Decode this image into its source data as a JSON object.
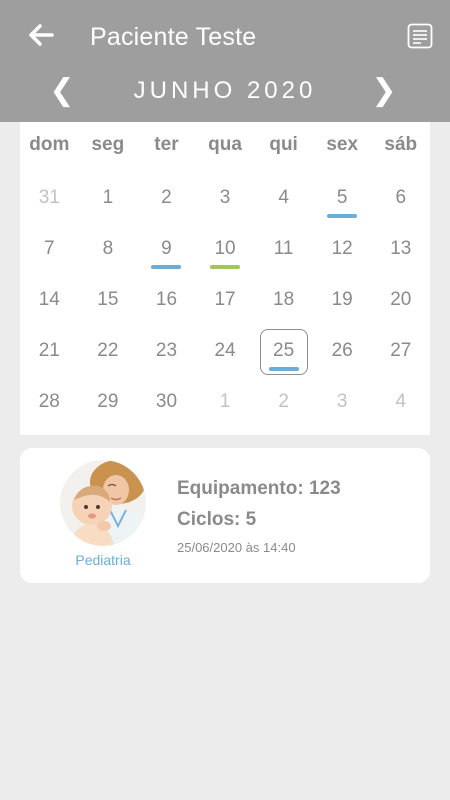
{
  "header": {
    "title": "Paciente Teste",
    "back_icon": "arrow-left-icon",
    "menu_icon": "document-list-icon",
    "background": "#9e9e9e"
  },
  "calendar": {
    "month_label": "JUNHO 2020",
    "prev_icon": "chevron-left-icon",
    "next_icon": "chevron-right-icon",
    "prev_glyph": "❮",
    "next_glyph": "❯",
    "weekdays": [
      "dom",
      "seg",
      "ter",
      "qua",
      "qui",
      "sex",
      "sáb"
    ],
    "weeks": [
      [
        {
          "day": "31",
          "other": true
        },
        {
          "day": "1"
        },
        {
          "day": "2"
        },
        {
          "day": "3"
        },
        {
          "day": "4"
        },
        {
          "day": "5",
          "mark": "#6aaed7"
        },
        {
          "day": "6"
        }
      ],
      [
        {
          "day": "7"
        },
        {
          "day": "8"
        },
        {
          "day": "9",
          "mark": "#6aaed7"
        },
        {
          "day": "10",
          "mark": "#a3c658"
        },
        {
          "day": "11"
        },
        {
          "day": "12"
        },
        {
          "day": "13"
        }
      ],
      [
        {
          "day": "14"
        },
        {
          "day": "15"
        },
        {
          "day": "16"
        },
        {
          "day": "17"
        },
        {
          "day": "18"
        },
        {
          "day": "19"
        },
        {
          "day": "20"
        }
      ],
      [
        {
          "day": "21"
        },
        {
          "day": "22"
        },
        {
          "day": "23"
        },
        {
          "day": "24"
        },
        {
          "day": "25",
          "mark": "#6aaed7",
          "selected": true
        },
        {
          "day": "26"
        },
        {
          "day": "27"
        }
      ],
      [
        {
          "day": "28"
        },
        {
          "day": "29"
        },
        {
          "day": "30"
        },
        {
          "day": "1",
          "other": true
        },
        {
          "day": "2",
          "other": true
        },
        {
          "day": "3",
          "other": true
        },
        {
          "day": "4",
          "other": true
        }
      ]
    ],
    "colors": {
      "mark_blue": "#6aaed7",
      "mark_green": "#a3c658"
    }
  },
  "record": {
    "avatar_icon": "pediatrics-photo",
    "category": "Pediatria",
    "equipment": "Equipamento: 123",
    "cycles": "Ciclos: 5",
    "timestamp": "25/06/2020 às 14:40"
  }
}
